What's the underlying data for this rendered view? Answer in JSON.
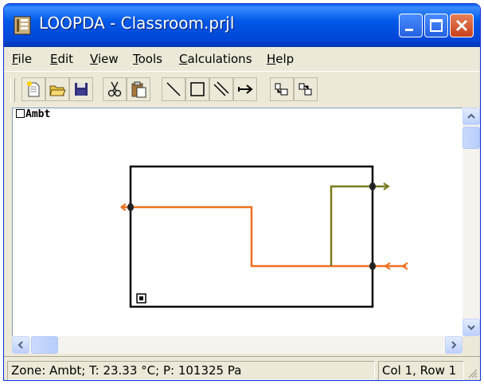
{
  "window": {
    "title": "LOOPDA - Classroom.prjl",
    "minimize_icon": "minimize-icon",
    "maximize_icon": "maximize-icon",
    "close_icon": "close-icon"
  },
  "menu": {
    "items": [
      {
        "underline": "F",
        "rest": "ile"
      },
      {
        "underline": "E",
        "rest": "dit"
      },
      {
        "underline": "V",
        "rest": "iew"
      },
      {
        "underline": "T",
        "rest": "ools"
      },
      {
        "underline": "C",
        "rest": "alculations"
      },
      {
        "underline": "H",
        "rest": "elp"
      }
    ]
  },
  "toolbar": {
    "buttons": [
      "new-icon",
      "open-icon",
      "save-icon",
      "cut-icon",
      "paste-icon",
      "line-icon",
      "rectangle-icon",
      "double-line-icon",
      "arrow-icon",
      "node-icon",
      "node2-icon"
    ]
  },
  "canvas": {
    "zone_label": "Ambt",
    "colors": {
      "orange": "#f07020",
      "olive": "#7a7a1e",
      "box": "#000000"
    }
  },
  "status": {
    "zone_info": "Zone: Ambt; T: 23.33 °C; P: 101325 Pa",
    "position": "Col 1, Row 1"
  }
}
